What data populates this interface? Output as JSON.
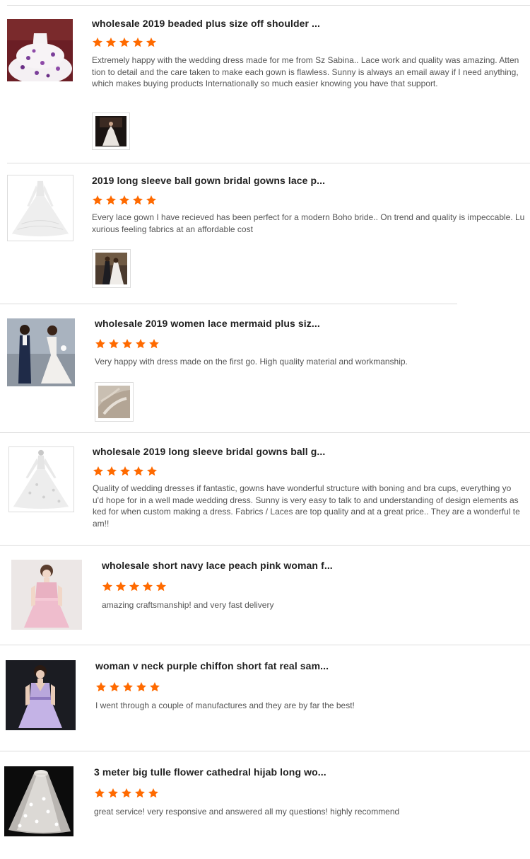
{
  "reviews": [
    {
      "title": "wholesale 2019 beaded plus size off shoulder ...",
      "rating": 5,
      "comment": "Extremely happy with the wedding dress made for me from Sz Sabina.. Lace work and quality was amazing. Attention to detail and the care taken to make each gown is flawless. Sunny is always an email away if I need anything,  which makes buying products Internationally so much easier knowing you have that support.",
      "has_photo": true
    },
    {
      "title": "2019 long sleeve ball gown bridal gowns lace p...",
      "rating": 5,
      "comment": "Every lace gown I have recieved has been perfect for a modern Boho bride.. On trend and quality is impeccable. Luxurious feeling fabrics at an affordable cost",
      "has_photo": true
    },
    {
      "title": "wholesale 2019 women lace mermaid plus siz...",
      "rating": 5,
      "comment": "Very happy with dress made on the first go. High quality material and workmanship.",
      "has_photo": true
    },
    {
      "title": "wholesale 2019 long sleeve bridal gowns ball g...",
      "rating": 5,
      "comment": "Quality of wedding dresses if fantastic, gowns have wonderful structure with boning and bra cups, everything you'd hope for in a well made wedding dress. Sunny is very easy to talk to and understanding of design elements asked for when custom making a dress. Fabrics / Laces are top quality and at a great price.. They are a wonderful team!!",
      "has_photo": false
    },
    {
      "title": "wholesale short navy lace peach pink woman f...",
      "rating": 5,
      "comment": "amazing craftsmanship! and very fast delivery",
      "has_photo": false
    },
    {
      "title": "woman v neck purple chiffon short fat real sam...",
      "rating": 5,
      "comment": "I went through a couple of manufactures and they are by far the best!",
      "has_photo": false
    },
    {
      "title": "3 meter big tulle flower cathedral hijab long wo...",
      "rating": 5,
      "comment": "great service! very responsive and answered all my questions! highly recommend",
      "has_photo": false
    }
  ],
  "colors": {
    "star": "#ff6a00",
    "divider": "#dcdcdc",
    "title": "#222222",
    "comment": "#555555"
  }
}
